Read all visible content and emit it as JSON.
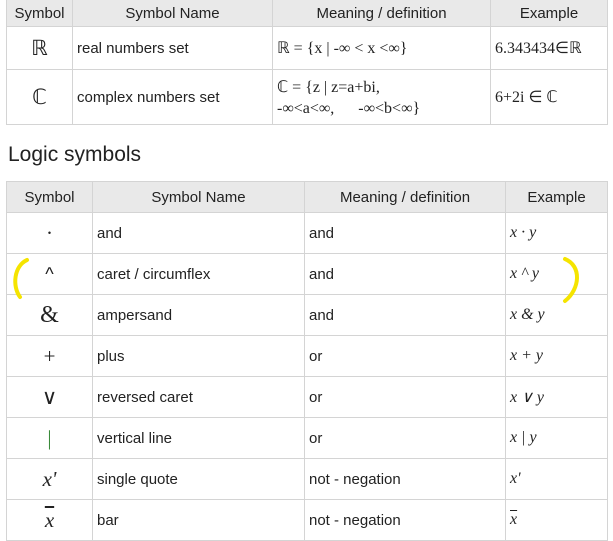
{
  "sets_table": {
    "headers": [
      "Symbol",
      "Symbol Name",
      "Meaning / definition",
      "Example"
    ],
    "rows": [
      {
        "symbol": "ℝ",
        "name": "real numbers set",
        "meaning": "ℝ = {x | -∞ < x <∞}",
        "example": "6.343434∈ℝ"
      },
      {
        "symbol": "ℂ",
        "name": "complex numbers set",
        "meaning_line1": "ℂ = {z | z=a+bi,",
        "meaning_line2": "-∞<a<∞,      -∞<b<∞}",
        "example": "6+2i ∈ ℂ"
      }
    ]
  },
  "logic_section": {
    "title": "Logic symbols",
    "headers": [
      "Symbol",
      "Symbol Name",
      "Meaning / definition",
      "Example"
    ],
    "rows": [
      {
        "symbol": "·",
        "name": "and",
        "meaning": "and",
        "example": "x · y"
      },
      {
        "symbol": "^",
        "name": "caret / circumflex",
        "meaning": "and",
        "example": "x ^ y"
      },
      {
        "symbol": "&",
        "name": "ampersand",
        "meaning": "and",
        "example": "x & y"
      },
      {
        "symbol": "+",
        "name": "plus",
        "meaning": "or",
        "example": "x + y"
      },
      {
        "symbol": "∨",
        "name": "reversed caret",
        "meaning": "or",
        "example": "x ∨ y"
      },
      {
        "symbol": "|",
        "name": "vertical line",
        "meaning": "or",
        "example": "x | y"
      },
      {
        "symbol": "x'",
        "name": "single quote",
        "meaning": "not - negation",
        "example": "x'"
      },
      {
        "symbol": "x",
        "name": "bar",
        "meaning": "not - negation",
        "example": "x"
      }
    ]
  },
  "annotation": {
    "color": "#f5e400"
  }
}
